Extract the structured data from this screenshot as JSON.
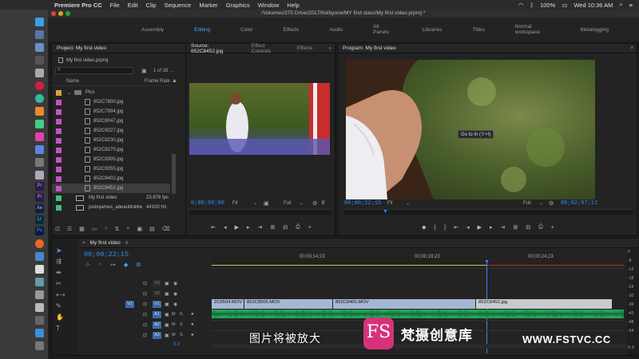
{
  "menubar": {
    "app_name": "Premiere Pro CC",
    "items": [
      "File",
      "Edit",
      "Clip",
      "Sequence",
      "Marker",
      "Graphics",
      "Window",
      "Help"
    ],
    "battery": "100%",
    "clock": "Wed 10:36 AM"
  },
  "window": {
    "title": "/Volumes/375 Drive/2017/Kelbyone/MY first class/My first video.prproj *"
  },
  "workspaces": [
    "Assembly",
    "Editing",
    "Color",
    "Effects",
    "Audio",
    "All Panels",
    "Libraries",
    "Titles",
    "Normal workspace",
    "Metalogging"
  ],
  "workspaces_active": "Editing",
  "project": {
    "tab": "Project: My first video",
    "file_name": "My first video.prproj",
    "item_count": "1 of 28 ...",
    "col_name": "Name",
    "col_framerate": "Frame Rate",
    "folder": "Pics",
    "files": [
      "852C7800.jpg",
      "852C7994.jpg",
      "852C8047.jpg",
      "852C8227.jpg",
      "852C8230.jpg",
      "852C8270.jpg",
      "852C8305.jpg",
      "852C8355.jpg",
      "852C8402.jpg",
      "852C8452.jpg"
    ],
    "seq_name": "My first video",
    "seq_rate": "23.976 fps",
    "audio_name": "justinjames_abeautifullife",
    "audio_rate": "44100 Hz"
  },
  "source": {
    "tabs": [
      "Source: 852C8452.jpg",
      "Effect Controls",
      "Effects"
    ],
    "timecode": "0;00;00;00",
    "fit": "Fit",
    "quality": "Full",
    "right_value": "0"
  },
  "program": {
    "tab": "Program: My first video",
    "timecode": "00;00;22;15",
    "fit": "Fit",
    "quality": "Full",
    "duration": "00;02;07;11",
    "tooltip": "Go to In (⇧+I)"
  },
  "timeline": {
    "tab": "My first video",
    "timecode": "00;00;22;15",
    "ruler": [
      "00;00;14;23",
      "00;00;19;23",
      "00;00;24;23"
    ],
    "video_tracks": [
      "V3",
      "V2",
      "V1"
    ],
    "audio_tracks": [
      "A1",
      "A2",
      "A3"
    ],
    "source_patch": "V1",
    "mix_value": "0.0",
    "clips": [
      "2C8504.MOV",
      "852C8506.MOV",
      "852C8465.MOV",
      "852C8452.jpg"
    ],
    "track_icon_m": "M",
    "track_icon_s": "S",
    "meter_labels": [
      "0",
      "-6",
      "-12",
      "-18",
      "-24",
      "-30",
      "-36",
      "-42",
      "-48",
      "-54"
    ],
    "meter_labels_bottom": "S  S"
  },
  "overlay": {
    "subtitle": "图片将被放大",
    "brand_logo": "FS",
    "brand_name": "梵摄创意库",
    "site": "WWW.FSTVC.CC"
  },
  "colors": {
    "accent": "#2f8cff",
    "audio_clip": "#27a35a",
    "video_clip": "#a6b7d6"
  }
}
